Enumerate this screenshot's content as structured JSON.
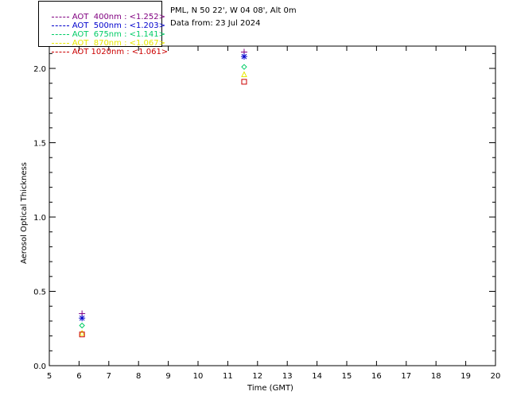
{
  "legend": [
    {
      "label": "AOT  400nm : <1.252>",
      "color": "#800080"
    },
    {
      "label": "AOT  500nm : <1.203>",
      "color": "#0000cc"
    },
    {
      "label": "AOT  675nm : <1.141>",
      "color": "#00cc66"
    },
    {
      "label": "AOT  870nm : <1.067>",
      "color": "#e8e800"
    },
    {
      "label": "AOT 1020nm : <1.061>",
      "color": "#cc0000"
    }
  ],
  "info": {
    "location": "PML, N 50 22', W 04 08', Alt 0m",
    "date": "Data from: 23 Jul 2024"
  },
  "chart_data": {
    "type": "scatter",
    "xlabel": "Time (GMT)",
    "ylabel": "Aerosol Optical Thickness",
    "xlim": [
      5,
      20
    ],
    "ylim": [
      0.0,
      2.15
    ],
    "xticks": [
      5,
      6,
      7,
      8,
      9,
      10,
      11,
      12,
      13,
      14,
      15,
      16,
      17,
      18,
      19,
      20
    ],
    "yticks": [
      "0.0",
      "0.5",
      "1.0",
      "1.5",
      "2.0"
    ],
    "series": [
      {
        "name": "AOT  400nm : <1.252>",
        "marker": "plus",
        "color": "#800080",
        "points": [
          {
            "x": 6.1,
            "y": 0.35
          },
          {
            "x": 11.55,
            "y": 2.11
          }
        ]
      },
      {
        "name": "AOT  500nm : <1.203>",
        "marker": "asterisk",
        "color": "#0000cc",
        "points": [
          {
            "x": 6.1,
            "y": 0.32
          },
          {
            "x": 11.55,
            "y": 2.08
          }
        ]
      },
      {
        "name": "AOT  675nm : <1.141>",
        "marker": "diamond",
        "color": "#00cc66",
        "points": [
          {
            "x": 6.1,
            "y": 0.27
          },
          {
            "x": 11.55,
            "y": 2.01
          }
        ]
      },
      {
        "name": "AOT  870nm : <1.067>",
        "marker": "triangle",
        "color": "#e8e800",
        "points": [
          {
            "x": 6.1,
            "y": 0.22
          },
          {
            "x": 11.55,
            "y": 1.96
          }
        ]
      },
      {
        "name": "AOT 1020nm : <1.061>",
        "marker": "square",
        "color": "#cc0000",
        "points": [
          {
            "x": 6.1,
            "y": 0.21
          },
          {
            "x": 11.55,
            "y": 1.91
          }
        ]
      }
    ]
  }
}
